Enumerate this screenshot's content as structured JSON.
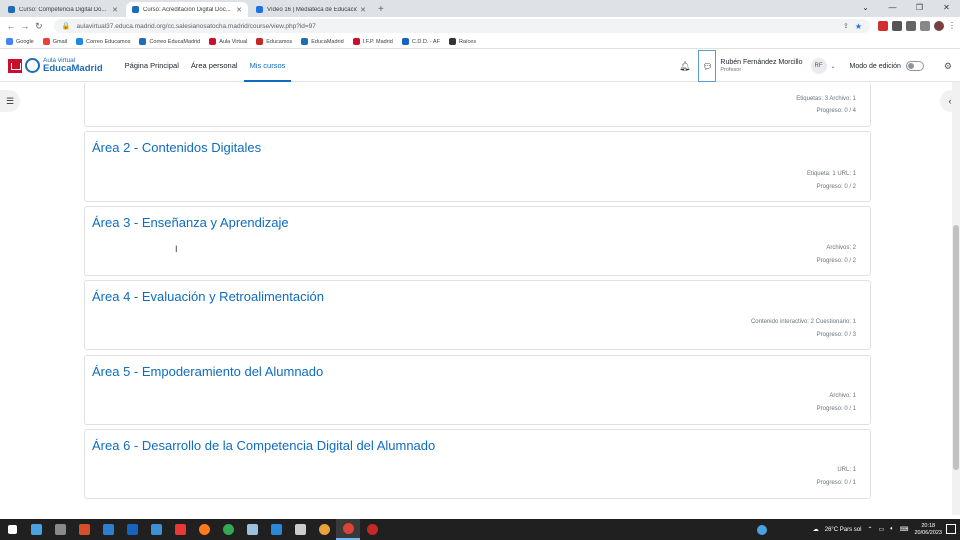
{
  "browser": {
    "tabs": [
      {
        "title": "Curso: Competencia Digital Do...",
        "color": "#1e6bb8",
        "active": false
      },
      {
        "title": "Curso: Acreditación Digital Doc...",
        "color": "#1e6bb8",
        "active": true
      },
      {
        "title": "Vídeo 16 | Mediateca de Educació...",
        "color": "#1a73e8",
        "active": false
      }
    ],
    "url": "aulavirtual37.educa.madrid.org/cc.salesianosatocha.madrid/course/view.php?id=97",
    "bookmarks": [
      {
        "label": "Google",
        "color": "#4285f4"
      },
      {
        "label": "Gmail",
        "color": "#ea4335"
      },
      {
        "label": "Correo Educamos",
        "color": "#1e88e5"
      },
      {
        "label": "Correo EducaMadrid",
        "color": "#1e6bb8"
      },
      {
        "label": "Aula Virtual",
        "color": "#c8102e"
      },
      {
        "label": "Educamos",
        "color": "#c62828"
      },
      {
        "label": "EducaMadrid",
        "color": "#1e6bb8"
      },
      {
        "label": "I.F.P. Madrid",
        "color": "#c8102e"
      },
      {
        "label": "C.D.D. - AF",
        "color": "#1565c0"
      },
      {
        "label": "Raíces",
        "color": "#333333"
      }
    ]
  },
  "navbar": {
    "logo_line1": "Aula virtual",
    "logo_line2": "EducaMadrid",
    "menu": [
      "Página Principal",
      "Área personal",
      "Mis cursos"
    ],
    "active_menu": "Mis cursos",
    "user_name": "Rubén Fernández Morcillo",
    "user_role": "Profesor",
    "avatar_initials": "RF",
    "edit_mode_label": "Modo de edición",
    "edit_mode_on": false
  },
  "sections": [
    {
      "title": "",
      "stats": "Etiquetas: 3   Archivo: 1",
      "progress": "Progreso: 0 / 4"
    },
    {
      "title": "Área 2 - Contenidos Digitales",
      "stats": "Etiqueta: 1   URL: 1",
      "progress": "Progreso: 0 / 2"
    },
    {
      "title": "Área 3 - Enseñanza y Aprendizaje",
      "stats": "Archivos: 2",
      "progress": "Progreso: 0 / 2"
    },
    {
      "title": "Área 4 - Evaluación y Retroalimentación",
      "stats": "Contenido interactivo: 2   Cuestionario: 1",
      "progress": "Progreso: 0 / 3"
    },
    {
      "title": "Área 5 - Empoderamiento del Alumnado",
      "stats": "Archivo: 1",
      "progress": "Progreso: 0 / 1"
    },
    {
      "title": "Área 6 - Desarrollo de la Competencia Digital del Alumnado",
      "stats": "URL: 1",
      "progress": "Progreso: 0 / 1"
    }
  ],
  "taskbar": {
    "weather": "26°C  Pars sol",
    "time": "20:18",
    "date": "20/06/2023"
  }
}
